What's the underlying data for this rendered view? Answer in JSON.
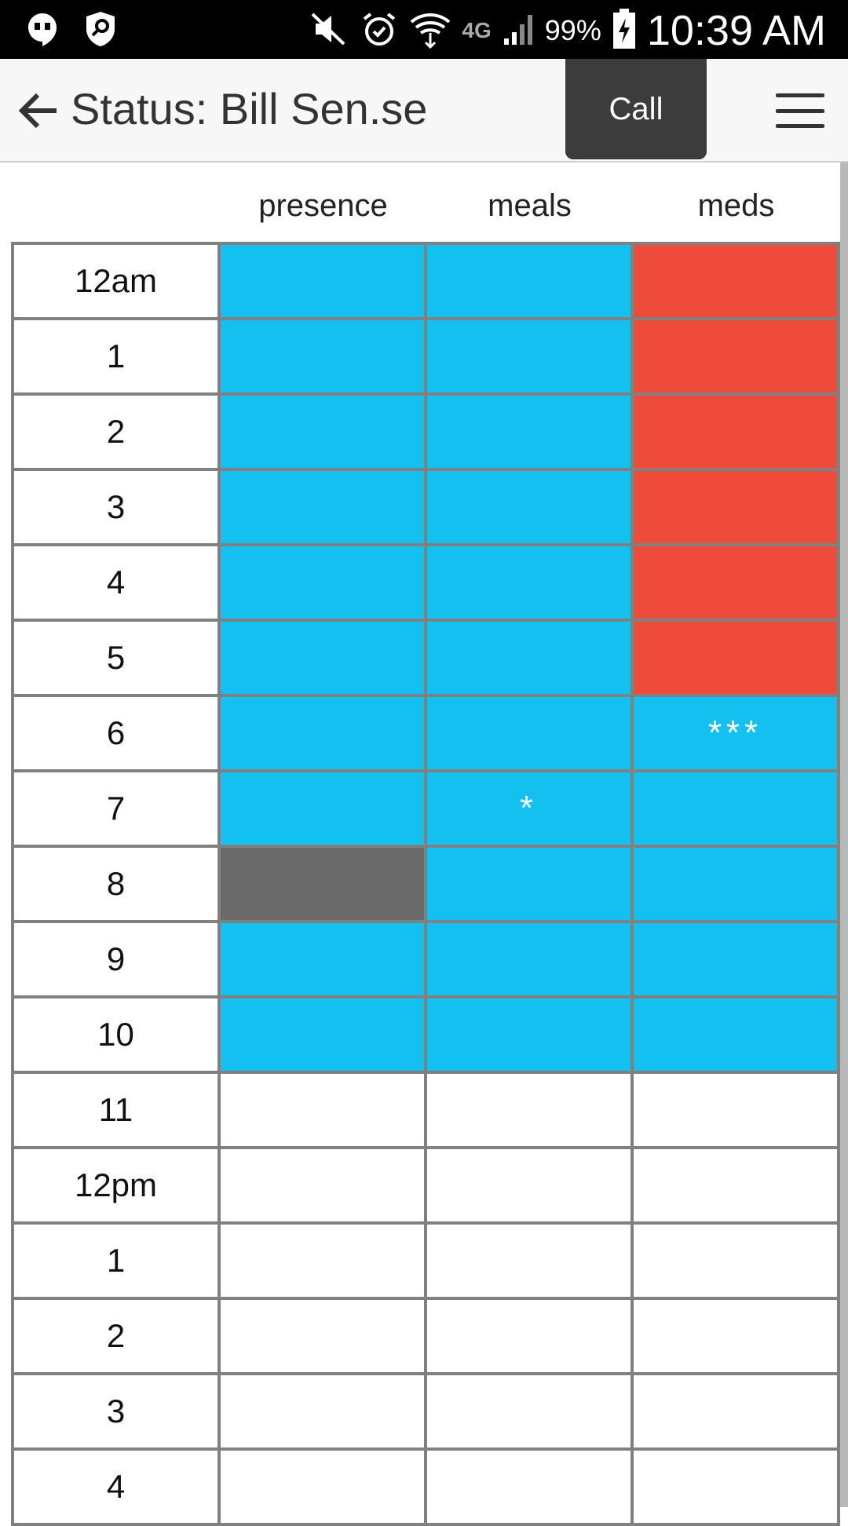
{
  "status_bar": {
    "time": "10:39 AM",
    "battery_percent": "99%",
    "network": "4G"
  },
  "app_bar": {
    "title": "Status: Bill Sen.se",
    "call_label": "Call"
  },
  "colors": {
    "present": "#13c0f0",
    "alert": "#ee4b3b",
    "missing": "#6a6a6a",
    "empty": "#ffffff"
  },
  "grid": {
    "columns": [
      "presence",
      "meals",
      "meds"
    ],
    "rows": [
      {
        "hour": "12am",
        "cells": [
          {
            "state": "present",
            "mark": ""
          },
          {
            "state": "present",
            "mark": ""
          },
          {
            "state": "alert",
            "mark": ""
          }
        ]
      },
      {
        "hour": "1",
        "cells": [
          {
            "state": "present",
            "mark": ""
          },
          {
            "state": "present",
            "mark": ""
          },
          {
            "state": "alert",
            "mark": ""
          }
        ]
      },
      {
        "hour": "2",
        "cells": [
          {
            "state": "present",
            "mark": ""
          },
          {
            "state": "present",
            "mark": ""
          },
          {
            "state": "alert",
            "mark": ""
          }
        ]
      },
      {
        "hour": "3",
        "cells": [
          {
            "state": "present",
            "mark": ""
          },
          {
            "state": "present",
            "mark": ""
          },
          {
            "state": "alert",
            "mark": ""
          }
        ]
      },
      {
        "hour": "4",
        "cells": [
          {
            "state": "present",
            "mark": ""
          },
          {
            "state": "present",
            "mark": ""
          },
          {
            "state": "alert",
            "mark": ""
          }
        ]
      },
      {
        "hour": "5",
        "cells": [
          {
            "state": "present",
            "mark": ""
          },
          {
            "state": "present",
            "mark": ""
          },
          {
            "state": "alert",
            "mark": ""
          }
        ]
      },
      {
        "hour": "6",
        "cells": [
          {
            "state": "present",
            "mark": ""
          },
          {
            "state": "present",
            "mark": ""
          },
          {
            "state": "present",
            "mark": "***"
          }
        ]
      },
      {
        "hour": "7",
        "cells": [
          {
            "state": "present",
            "mark": ""
          },
          {
            "state": "present",
            "mark": "*"
          },
          {
            "state": "present",
            "mark": ""
          }
        ]
      },
      {
        "hour": "8",
        "cells": [
          {
            "state": "missing",
            "mark": ""
          },
          {
            "state": "present",
            "mark": ""
          },
          {
            "state": "present",
            "mark": ""
          }
        ]
      },
      {
        "hour": "9",
        "cells": [
          {
            "state": "present",
            "mark": ""
          },
          {
            "state": "present",
            "mark": ""
          },
          {
            "state": "present",
            "mark": ""
          }
        ]
      },
      {
        "hour": "10",
        "cells": [
          {
            "state": "present",
            "mark": ""
          },
          {
            "state": "present",
            "mark": ""
          },
          {
            "state": "present",
            "mark": ""
          }
        ]
      },
      {
        "hour": "11",
        "cells": [
          {
            "state": "empty",
            "mark": ""
          },
          {
            "state": "empty",
            "mark": ""
          },
          {
            "state": "empty",
            "mark": ""
          }
        ]
      },
      {
        "hour": "12pm",
        "cells": [
          {
            "state": "empty",
            "mark": ""
          },
          {
            "state": "empty",
            "mark": ""
          },
          {
            "state": "empty",
            "mark": ""
          }
        ]
      },
      {
        "hour": "1",
        "cells": [
          {
            "state": "empty",
            "mark": ""
          },
          {
            "state": "empty",
            "mark": ""
          },
          {
            "state": "empty",
            "mark": ""
          }
        ]
      },
      {
        "hour": "2",
        "cells": [
          {
            "state": "empty",
            "mark": ""
          },
          {
            "state": "empty",
            "mark": ""
          },
          {
            "state": "empty",
            "mark": ""
          }
        ]
      },
      {
        "hour": "3",
        "cells": [
          {
            "state": "empty",
            "mark": ""
          },
          {
            "state": "empty",
            "mark": ""
          },
          {
            "state": "empty",
            "mark": ""
          }
        ]
      },
      {
        "hour": "4",
        "cells": [
          {
            "state": "empty",
            "mark": ""
          },
          {
            "state": "empty",
            "mark": ""
          },
          {
            "state": "empty",
            "mark": ""
          }
        ]
      }
    ]
  }
}
